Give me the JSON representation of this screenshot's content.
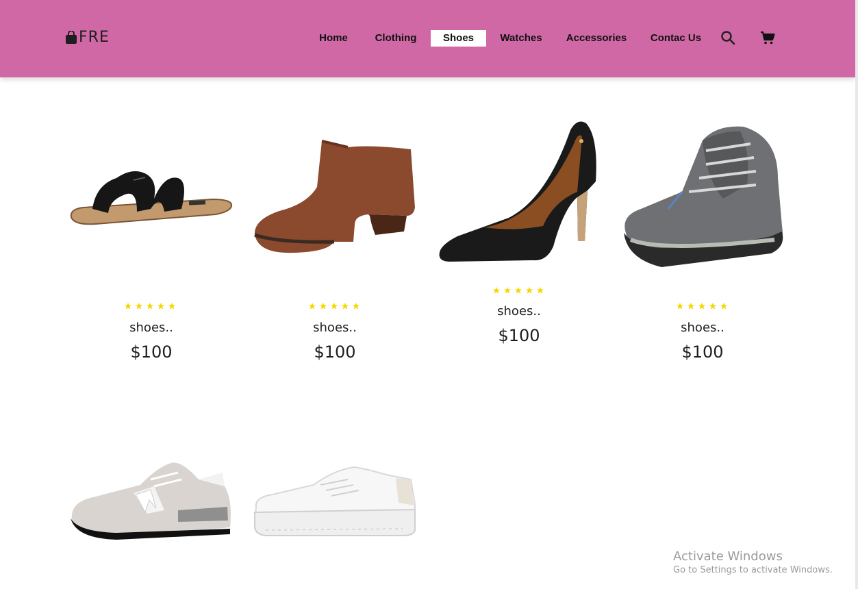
{
  "header": {
    "logo_text": "FRE",
    "nav": [
      {
        "label": "Home",
        "active": false
      },
      {
        "label": "Clothing",
        "active": false
      },
      {
        "label": "Shoes",
        "active": true
      },
      {
        "label": "Watches",
        "active": false
      },
      {
        "label": "Accessories",
        "active": false
      },
      {
        "label": "Contac Us",
        "active": false
      }
    ],
    "icons": [
      "search-icon",
      "cart-icon"
    ],
    "brand_color": "#cf68a4"
  },
  "products": [
    {
      "name": "shoes..",
      "price": "$100",
      "rating": 5,
      "image": "black-slide-sandal"
    },
    {
      "name": "shoes..",
      "price": "$100",
      "rating": 5,
      "image": "brown-suede-ankle-boot"
    },
    {
      "name": "shoes..",
      "price": "$100",
      "rating": 5,
      "image": "black-stiletto-pump"
    },
    {
      "name": "shoes..",
      "price": "$100",
      "rating": 5,
      "image": "grey-hiking-boot"
    },
    {
      "name": "",
      "price": "",
      "rating": 0,
      "image": "grey-running-sneaker"
    },
    {
      "name": "",
      "price": "",
      "rating": 0,
      "image": "white-platform-sneaker"
    }
  ],
  "os_watermark": {
    "line1": "Activate Windows",
    "line2": "Go to Settings to activate Windows."
  },
  "colors": {
    "star": "#f5d800",
    "text": "#1e1e1e"
  }
}
